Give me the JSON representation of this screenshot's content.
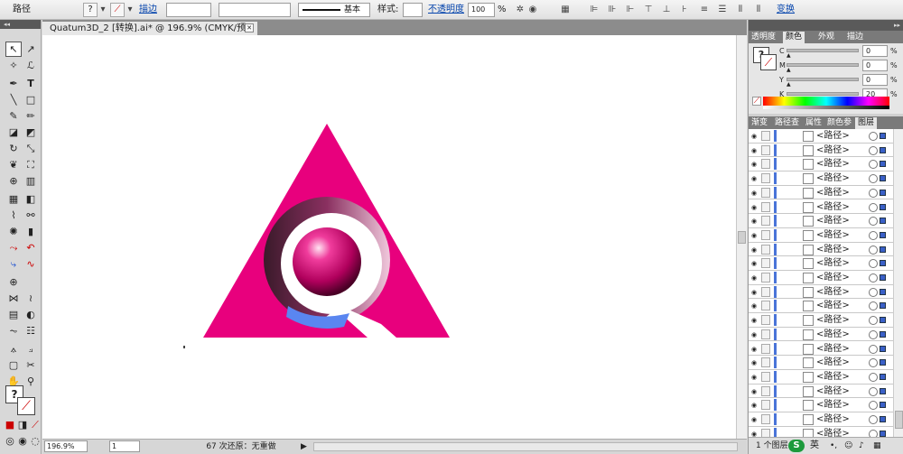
{
  "control": {
    "object_type": "路径",
    "stroke_link": "描边",
    "stroke_preset": "基本",
    "style_label": "样式:",
    "opacity_link": "不透明度",
    "opacity_value": "100",
    "percent": "%",
    "transform_link": "变换"
  },
  "document": {
    "tab_title": "Quatum3D_2  [转换].ai* @ 196.9% (CMYK/预览)"
  },
  "status": {
    "zoom": "196.9%",
    "artboard": "1",
    "message": "67 次还原：无重做"
  },
  "color_panel": {
    "tabs": [
      "透明度",
      "颜色",
      "外观",
      "描边"
    ],
    "channels": [
      {
        "label": "C",
        "value": "0"
      },
      {
        "label": "M",
        "value": "0"
      },
      {
        "label": "Y",
        "value": "0"
      },
      {
        "label": "K",
        "value": "20"
      }
    ],
    "percent": "%"
  },
  "layers_panel": {
    "tabs": [
      "渐变",
      "路径查",
      "属性",
      "颜色参",
      "图层"
    ],
    "rows": [
      "<路径>",
      "<路径>",
      "<路径>",
      "<路径>",
      "<路径>",
      "<路径>",
      "<路径>",
      "<路径>",
      "<路径>",
      "<路径>",
      "<路径>",
      "<路径>",
      "<路径>",
      "<路径>",
      "<路径>",
      "<路径>",
      "<路径>",
      "<路径>",
      "<路径>",
      "<路径>",
      "<路径>",
      "<路径>"
    ],
    "footer": "1 个图层",
    "ime": "英"
  },
  "colors": {
    "magenta": "#e8007d",
    "sphere": "#b0005c",
    "blue_band": "#5a86f0",
    "ring": "#ffffff"
  }
}
